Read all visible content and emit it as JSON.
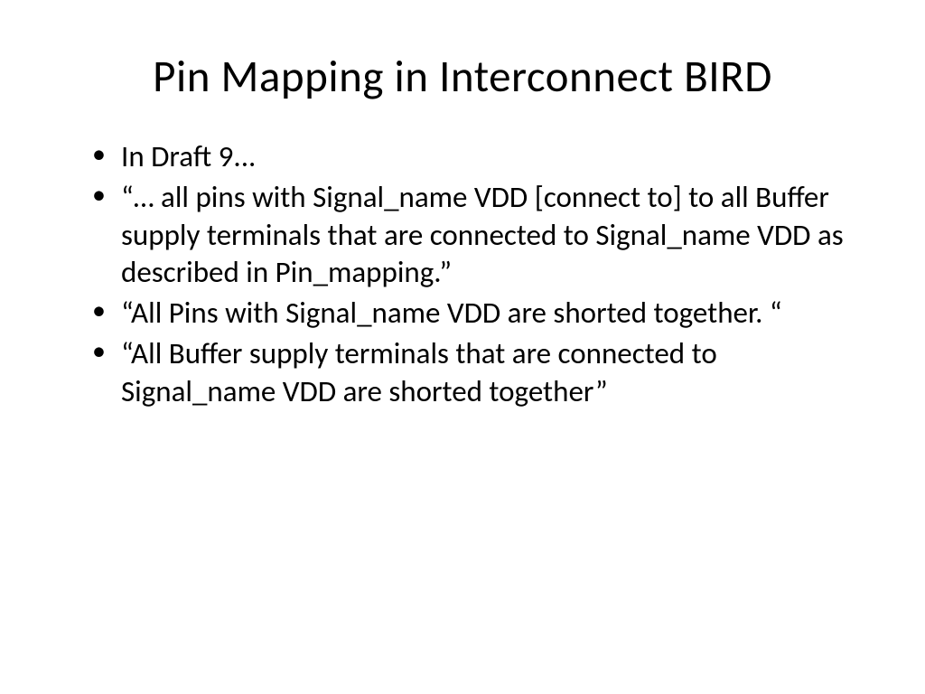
{
  "slide": {
    "title": "Pin Mapping in Interconnect BIRD",
    "bullets": [
      "In Draft 9...",
      "“… all pins with Signal_name VDD [connect to] to all Buffer supply terminals that are connected to Signal_name VDD as described in Pin_mapping.”",
      "“All Pins with Signal_name VDD are shorted together. “",
      "“All Buffer supply terminals that are connected to Signal_name VDD are shorted together”"
    ]
  }
}
